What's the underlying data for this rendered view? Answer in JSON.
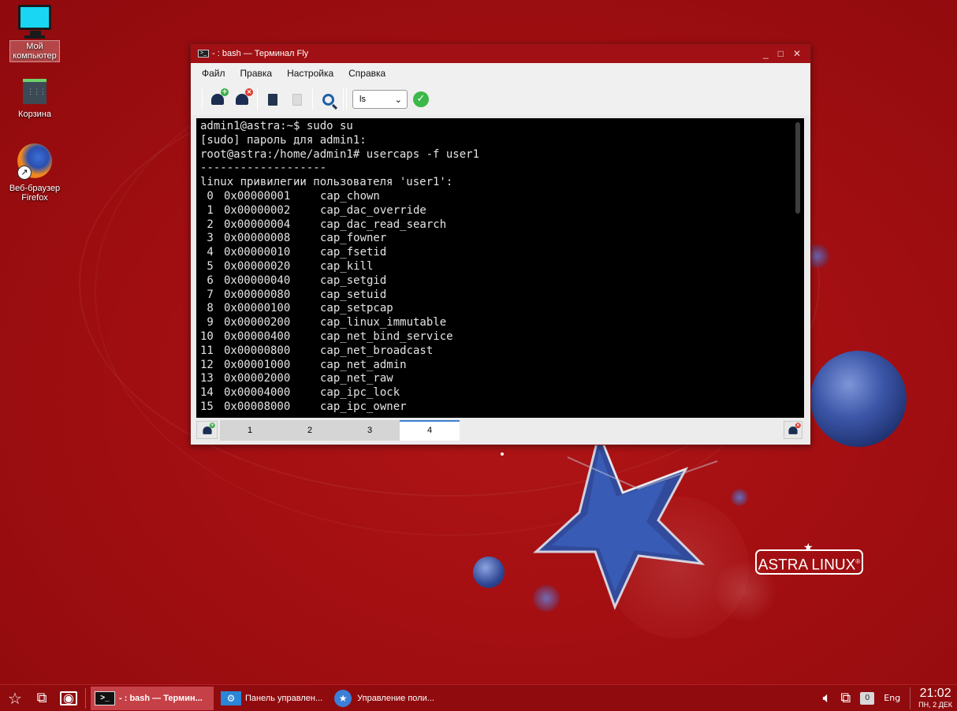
{
  "desktop": {
    "icons": [
      {
        "label_line1": "Мой",
        "label_line2": "компьютер"
      },
      {
        "label": "Корзина"
      },
      {
        "label_line1": "Веб-браузер",
        "label_line2": "Firefox"
      }
    ],
    "logo_text": "ASTRA LINUX",
    "logo_mark": "®"
  },
  "window": {
    "title": "- : bash — Терминал Fly",
    "title_icon": ">_",
    "controls": {
      "minimize": "_",
      "maximize": "□",
      "close": "✕"
    },
    "menu": [
      "Файл",
      "Правка",
      "Настройка",
      "Справка"
    ],
    "toolbar": {
      "icons": [
        "new-session-icon",
        "close-session-icon",
        "copy-icon",
        "paste-icon",
        "search-icon",
        "run-command-icon"
      ],
      "command_value": "ls",
      "dropdown_arrow": "⌄"
    },
    "terminal": {
      "lines": [
        "admin1@astra:~$ sudo su",
        "[sudo] пароль для admin1:",
        "root@astra:/home/admin1# usercaps -f user1",
        "-------------------",
        "linux привилегии пользователя 'user1':"
      ],
      "caps": [
        {
          "n": "0",
          "hex": "0x00000001",
          "name": "cap_chown"
        },
        {
          "n": "1",
          "hex": "0x00000002",
          "name": "cap_dac_override"
        },
        {
          "n": "2",
          "hex": "0x00000004",
          "name": "cap_dac_read_search"
        },
        {
          "n": "3",
          "hex": "0x00000008",
          "name": "cap_fowner"
        },
        {
          "n": "4",
          "hex": "0x00000010",
          "name": "cap_fsetid"
        },
        {
          "n": "5",
          "hex": "0x00000020",
          "name": "cap_kill"
        },
        {
          "n": "6",
          "hex": "0x00000040",
          "name": "cap_setgid"
        },
        {
          "n": "7",
          "hex": "0x00000080",
          "name": "cap_setuid"
        },
        {
          "n": "8",
          "hex": "0x00000100",
          "name": "cap_setpcap"
        },
        {
          "n": "9",
          "hex": "0x00000200",
          "name": "cap_linux_immutable"
        },
        {
          "n": "10",
          "hex": "0x00000400",
          "name": "cap_net_bind_service"
        },
        {
          "n": "11",
          "hex": "0x00000800",
          "name": "cap_net_broadcast"
        },
        {
          "n": "12",
          "hex": "0x00001000",
          "name": "cap_net_admin"
        },
        {
          "n": "13",
          "hex": "0x00002000",
          "name": "cap_net_raw"
        },
        {
          "n": "14",
          "hex": "0x00004000",
          "name": "cap_ipc_lock"
        },
        {
          "n": "15",
          "hex": "0x00008000",
          "name": "cap_ipc_owner"
        }
      ]
    },
    "tabs": [
      "1",
      "2",
      "3",
      "4"
    ],
    "active_tab": "4"
  },
  "taskbar": {
    "tasks": [
      {
        "label": "- : bash — Термин...",
        "active": true
      },
      {
        "label": "Панель управлен...",
        "active": false
      },
      {
        "label": "Управление поли...",
        "active": false
      }
    ],
    "tray": {
      "badge": "0",
      "lang": "Eng",
      "time": "21:02",
      "date": "ПН, 2 ДЕК"
    }
  },
  "colors": {
    "wallpaper": "#a30f12",
    "titlebar": "#a01014",
    "taskbar": "#8f0b0e",
    "active_task": "#c64147",
    "terminal_bg": "#000000",
    "terminal_fg": "#e4e4e4"
  }
}
